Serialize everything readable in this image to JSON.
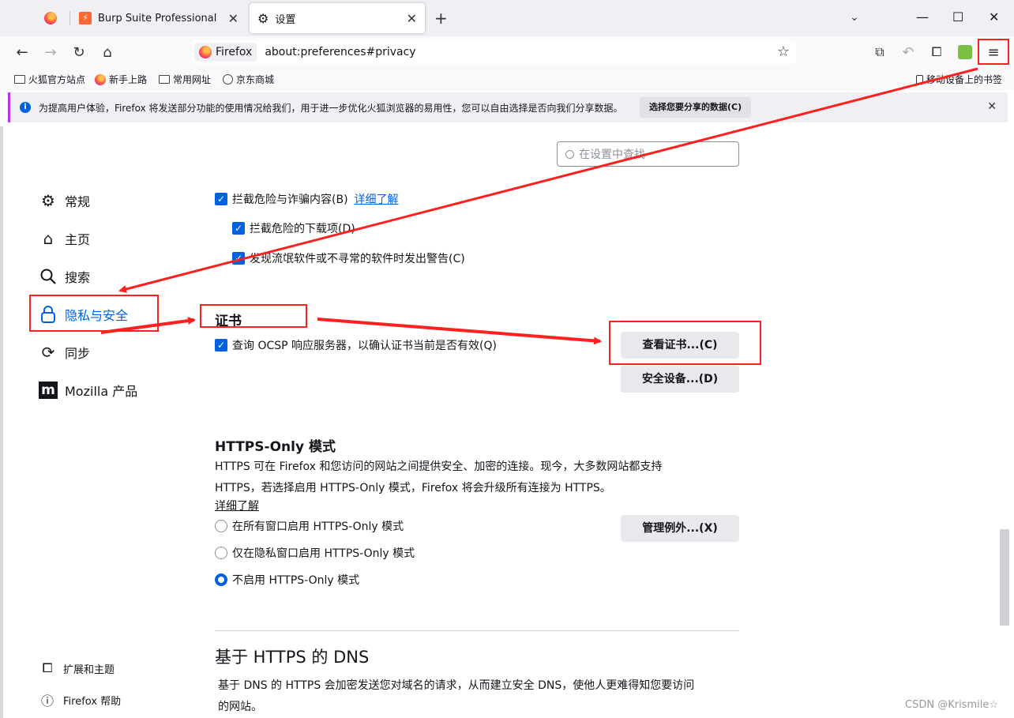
{
  "tabs": [
    {
      "label": "",
      "icon": "firefox-icon",
      "pinned": true
    },
    {
      "label": "Burp Suite Professional",
      "icon": "burp-icon"
    },
    {
      "label": "设置",
      "icon": "gear-icon",
      "active": true
    }
  ],
  "urlbar": {
    "identity": "Firefox",
    "url": "about:preferences#privacy"
  },
  "bookmarks": [
    {
      "label": "火狐官方站点",
      "icon": "folder-icon"
    },
    {
      "label": "新手上路",
      "icon": "firefox-icon"
    },
    {
      "label": "常用网址",
      "icon": "folder-icon"
    },
    {
      "label": "京东商城",
      "icon": "globe-icon"
    }
  ],
  "bookmarks_mobile": "移动设备上的书签",
  "notification": {
    "text": "为提高用户体验，Firefox 将发送部分功能的使用情况给我们，用于进一步优化火狐浏览器的易用性，您可以自由选择是否向我们分享数据。",
    "button": "选择您要分享的数据(C)"
  },
  "search": {
    "placeholder": "在设置中查找"
  },
  "sidebar": {
    "items": [
      {
        "label": "常规",
        "icon": "gear-icon"
      },
      {
        "label": "主页",
        "icon": "home-icon"
      },
      {
        "label": "搜索",
        "icon": "search-icon"
      },
      {
        "label": "隐私与安全",
        "icon": "lock-icon",
        "selected": true
      },
      {
        "label": "同步",
        "icon": "sync-icon"
      },
      {
        "label": "Mozilla 产品",
        "icon": "mozilla-icon"
      }
    ],
    "bottom": [
      {
        "label": "扩展和主题",
        "icon": "puzzle-icon"
      },
      {
        "label": "Firefox 帮助",
        "icon": "help-icon"
      }
    ]
  },
  "security": {
    "block_dangerous": "拦截危险与诈骗内容(B)",
    "learn_more": "详细了解",
    "block_downloads": "拦截危险的下载项(D)",
    "warn_unwanted": "发现流氓软件或不寻常的软件时发出警告(C)"
  },
  "certificates": {
    "title": "证书",
    "ocsp": "查询 OCSP 响应服务器，以确认证书当前是否有效(Q)",
    "view_button": "查看证书...(C)",
    "devices_button": "安全设备...(D)"
  },
  "https_only": {
    "title": "HTTPS-Only 模式",
    "desc1": "HTTPS 可在 Firefox 和您访问的网站之间提供安全、加密的连接。现今，大多数网站都支持",
    "desc2": "HTTPS，若选择启用 HTTPS-Only 模式，Firefox 将会升级所有连接为 HTTPS。",
    "learn_more": "详细了解",
    "options": [
      "在所有窗口启用 HTTPS-Only 模式",
      "仅在隐私窗口启用 HTTPS-Only 模式",
      "不启用 HTTPS-Only 模式"
    ],
    "selected_index": 2,
    "exceptions_button": "管理例外...(X)"
  },
  "dns": {
    "title": "基于 HTTPS 的 DNS",
    "desc1": "基于 DNS 的 HTTPS 会加密发送您对域名的请求，从而建立安全 DNS，使他人更难得知您要访问",
    "desc2": "的网站。"
  },
  "watermark": "CSDN @Krismile☆",
  "colors": {
    "accent": "#0061e0",
    "annotation": "#ff2020"
  }
}
